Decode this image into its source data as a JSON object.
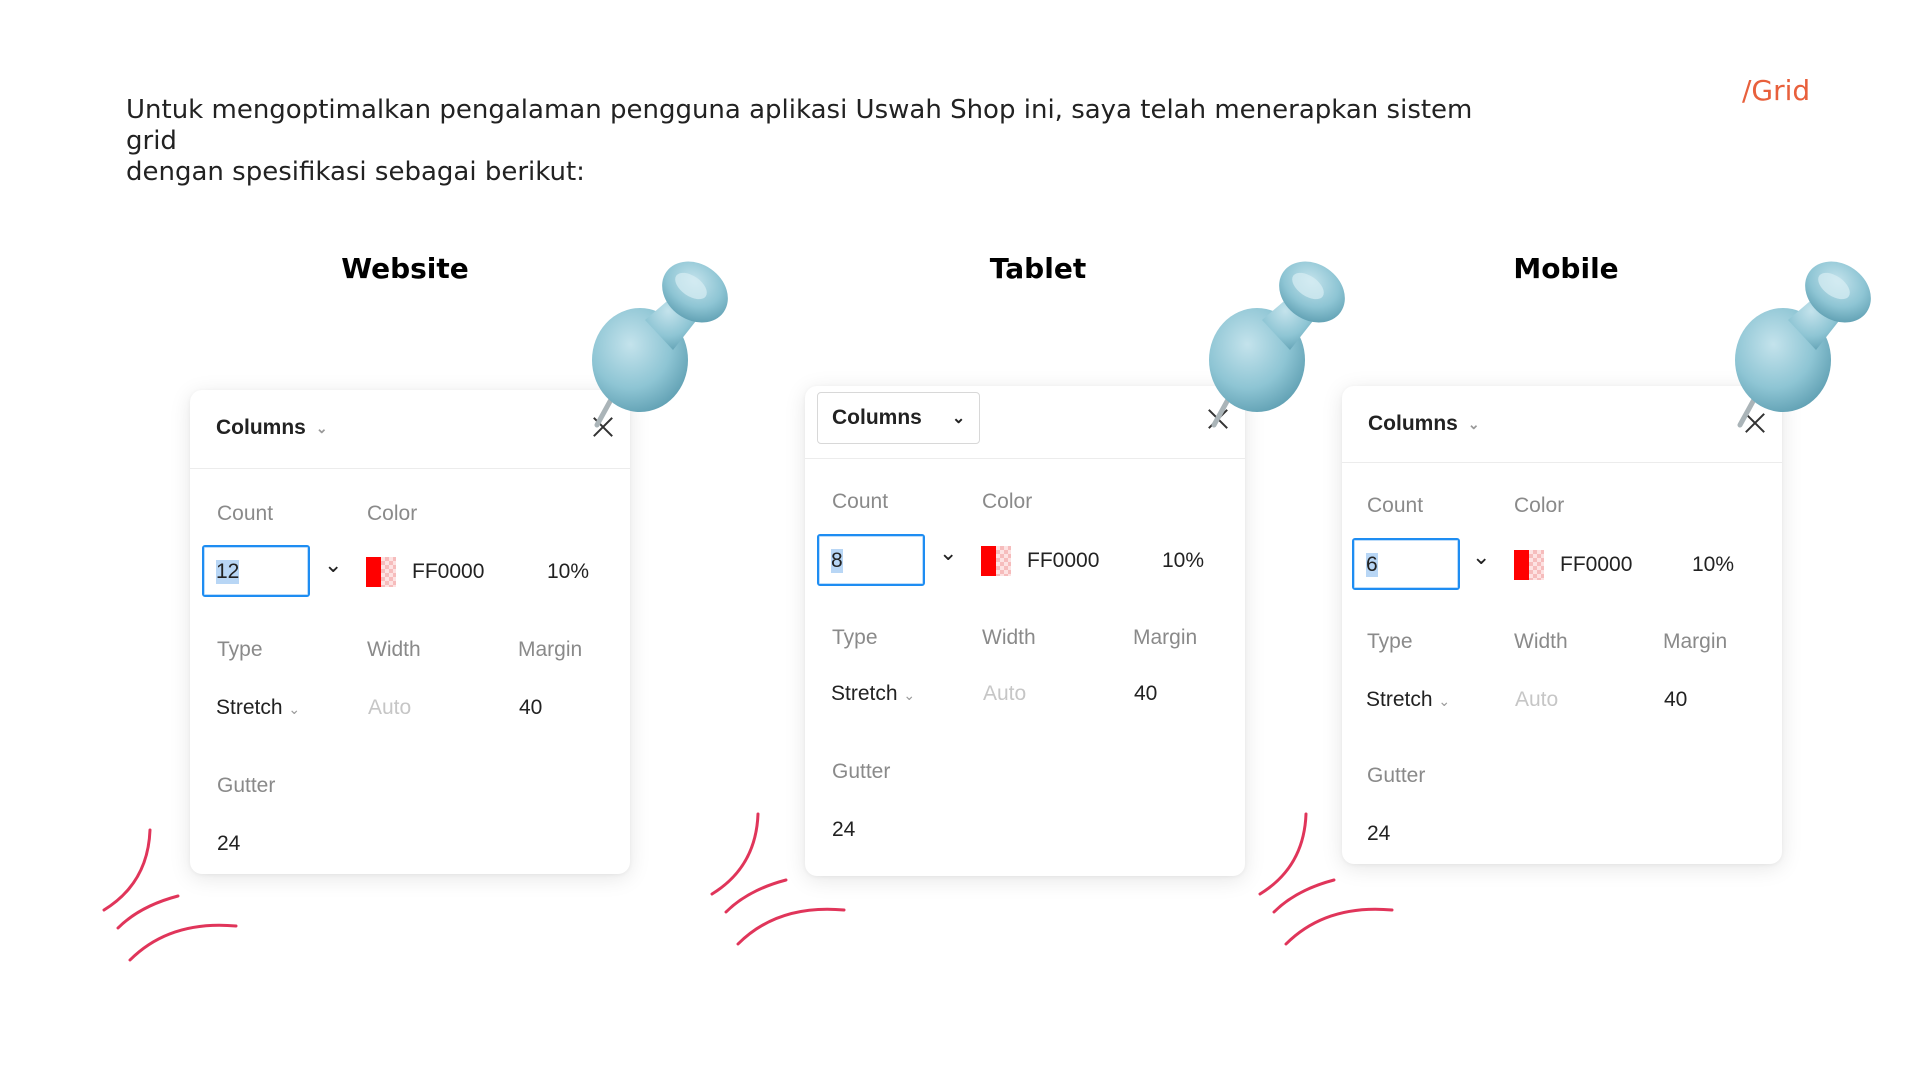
{
  "intro": {
    "line1": "Untuk mengoptimalkan pengalaman pengguna aplikasi Uswah Shop ini, saya telah menerapkan sistem grid",
    "line2": "dengan spesifikasi sebagai berikut:"
  },
  "tag": "/Grid",
  "colors": {
    "accent": "#e8603c",
    "pin": "#8ec5d4",
    "scribble": "#e0355a",
    "selection": "#1e8df2",
    "swatch": "#ff0000"
  },
  "panels": [
    {
      "heading": "Website",
      "mode": "Columns",
      "labels": {
        "count": "Count",
        "color": "Color",
        "type": "Type",
        "width": "Width",
        "margin": "Margin",
        "gutter": "Gutter"
      },
      "count": "12",
      "color_hex": "FF0000",
      "opacity": "10%",
      "type": "Stretch",
      "width": "Auto",
      "margin": "40",
      "gutter": "24"
    },
    {
      "heading": "Tablet",
      "mode": "Columns",
      "labels": {
        "count": "Count",
        "color": "Color",
        "type": "Type",
        "width": "Width",
        "margin": "Margin",
        "gutter": "Gutter"
      },
      "count": "8",
      "color_hex": "FF0000",
      "opacity": "10%",
      "type": "Stretch",
      "width": "Auto",
      "margin": "40",
      "gutter": "24"
    },
    {
      "heading": "Mobile",
      "mode": "Columns",
      "labels": {
        "count": "Count",
        "color": "Color",
        "type": "Type",
        "width": "Width",
        "margin": "Margin",
        "gutter": "Gutter"
      },
      "count": "6",
      "color_hex": "FF0000",
      "opacity": "10%",
      "type": "Stretch",
      "width": "Auto",
      "margin": "40",
      "gutter": "24"
    }
  ],
  "icons": [
    "pushpin-icon",
    "close-icon",
    "chevron-down-icon",
    "color-swatch-icon",
    "scribble-decoration"
  ]
}
